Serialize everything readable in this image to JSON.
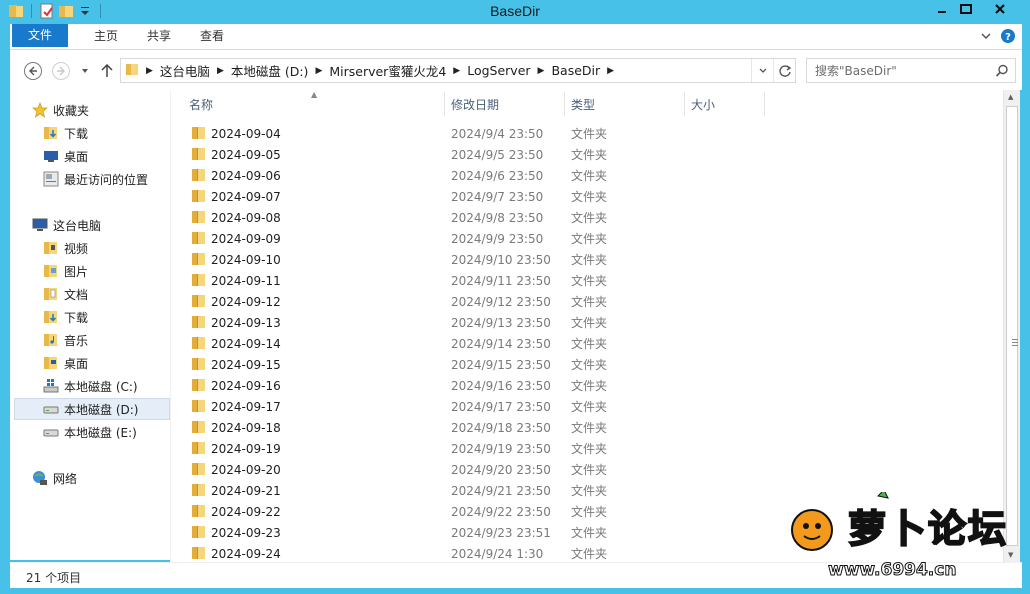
{
  "window": {
    "title": "BaseDir",
    "frame_color": "#47c1e8",
    "accent": "#1979ca"
  },
  "ribbon": {
    "tabs": [
      "文件",
      "主页",
      "共享",
      "查看"
    ]
  },
  "address": {
    "crumbs": [
      "这台电脑",
      "本地磁盘 (D:)",
      "Mirserver蜜獾火龙4",
      "LogServer",
      "BaseDir"
    ],
    "search_placeholder": "搜索\"BaseDir\""
  },
  "nav": {
    "favorites": {
      "label": "收藏夹",
      "items": [
        "下载",
        "桌面",
        "最近访问的位置"
      ]
    },
    "computer": {
      "label": "这台电脑",
      "items": [
        "视频",
        "图片",
        "文档",
        "下载",
        "音乐",
        "桌面",
        "本地磁盘 (C:)",
        "本地磁盘 (D:)",
        "本地磁盘 (E:)"
      ],
      "selected": "本地磁盘 (D:)"
    },
    "network": {
      "label": "网络"
    }
  },
  "columns": [
    "名称",
    "修改日期",
    "类型",
    "大小"
  ],
  "files": [
    {
      "name": "2024-09-04",
      "date": "2024/9/4 23:50",
      "type": "文件夹"
    },
    {
      "name": "2024-09-05",
      "date": "2024/9/5 23:50",
      "type": "文件夹"
    },
    {
      "name": "2024-09-06",
      "date": "2024/9/6 23:50",
      "type": "文件夹"
    },
    {
      "name": "2024-09-07",
      "date": "2024/9/7 23:50",
      "type": "文件夹"
    },
    {
      "name": "2024-09-08",
      "date": "2024/9/8 23:50",
      "type": "文件夹"
    },
    {
      "name": "2024-09-09",
      "date": "2024/9/9 23:50",
      "type": "文件夹"
    },
    {
      "name": "2024-09-10",
      "date": "2024/9/10 23:50",
      "type": "文件夹"
    },
    {
      "name": "2024-09-11",
      "date": "2024/9/11 23:50",
      "type": "文件夹"
    },
    {
      "name": "2024-09-12",
      "date": "2024/9/12 23:50",
      "type": "文件夹"
    },
    {
      "name": "2024-09-13",
      "date": "2024/9/13 23:50",
      "type": "文件夹"
    },
    {
      "name": "2024-09-14",
      "date": "2024/9/14 23:50",
      "type": "文件夹"
    },
    {
      "name": "2024-09-15",
      "date": "2024/9/15 23:50",
      "type": "文件夹"
    },
    {
      "name": "2024-09-16",
      "date": "2024/9/16 23:50",
      "type": "文件夹"
    },
    {
      "name": "2024-09-17",
      "date": "2024/9/17 23:50",
      "type": "文件夹"
    },
    {
      "name": "2024-09-18",
      "date": "2024/9/18 23:50",
      "type": "文件夹"
    },
    {
      "name": "2024-09-19",
      "date": "2024/9/19 23:50",
      "type": "文件夹"
    },
    {
      "name": "2024-09-20",
      "date": "2024/9/20 23:50",
      "type": "文件夹"
    },
    {
      "name": "2024-09-21",
      "date": "2024/9/21 23:50",
      "type": "文件夹"
    },
    {
      "name": "2024-09-22",
      "date": "2024/9/22 23:50",
      "type": "文件夹"
    },
    {
      "name": "2024-09-23",
      "date": "2024/9/23 23:51",
      "type": "文件夹"
    },
    {
      "name": "2024-09-24",
      "date": "2024/9/24 1:30",
      "type": "文件夹"
    }
  ],
  "status": {
    "count": "21 个项目"
  },
  "watermark": {
    "text": "萝卜论坛",
    "url": "www.6994.cn"
  }
}
